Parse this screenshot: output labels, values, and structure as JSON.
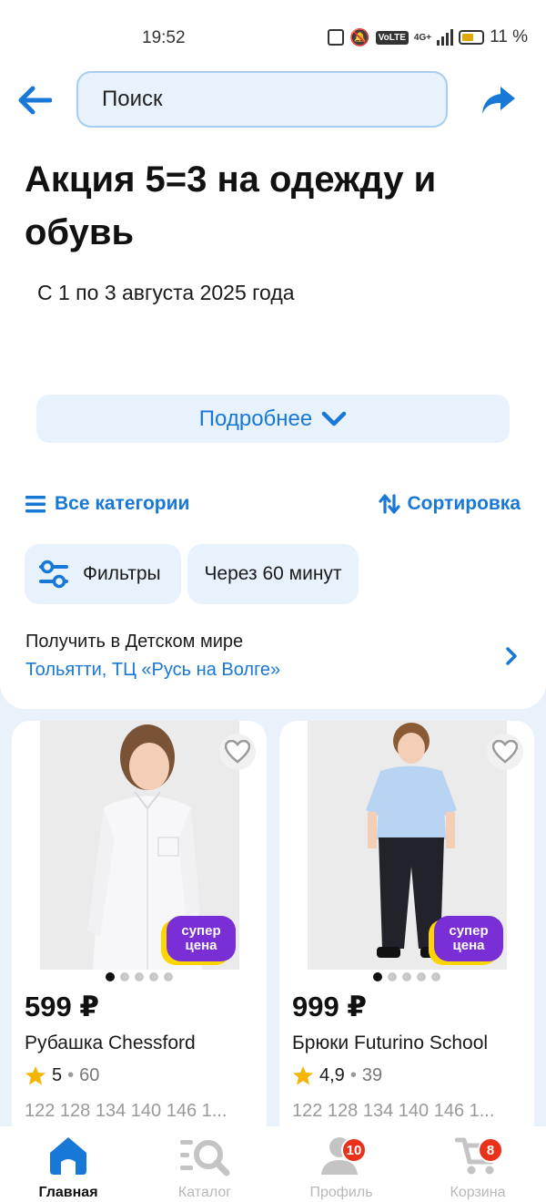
{
  "status_bar": {
    "time": "19:52",
    "network": "4G+",
    "battery": "11 %"
  },
  "header": {
    "search_placeholder": "Поиск"
  },
  "promo": {
    "title": "Акция 5=3 на одежду и обувь",
    "dates": "С 1 по 3 августа 2025 года",
    "more_label": "Подробнее"
  },
  "toolbar": {
    "categories_label": "Все категории",
    "sort_label": "Сортировка"
  },
  "chips": {
    "filters_label": "Фильтры",
    "time_label": "Через 60 минут"
  },
  "pickup": {
    "label": "Получить в Детском мире",
    "store": "Тольятти, ТЦ «Русь на Волге»"
  },
  "products": [
    {
      "price": "599 ₽",
      "name": "Рубашка Chessford",
      "rating": "5",
      "reviews": "60",
      "sizes": "122 128 134 140 146 1...",
      "badge_line1": "супер",
      "badge_line2": "цена"
    },
    {
      "price": "999 ₽",
      "name": "Брюки Futurino School",
      "rating": "4,9",
      "reviews": "39",
      "sizes": "122 128 134 140 146 1...",
      "badge_line1": "супер",
      "badge_line2": "цена"
    }
  ],
  "bottom_nav": {
    "home": "Главная",
    "catalog": "Каталог",
    "profile": "Профиль",
    "profile_badge": "10",
    "cart": "Корзина",
    "cart_badge": "8"
  },
  "colors": {
    "accent": "#1878d8",
    "badge_red": "#e8321c",
    "super_price_purple": "#7a2fd6",
    "super_price_yellow": "#ffd500",
    "star": "#f5b400"
  },
  "icons": [
    "back-arrow-icon",
    "share-icon",
    "chevron-down-icon",
    "menu-lines-icon",
    "sort-arrows-icon",
    "filter-sliders-icon",
    "chevron-right-icon",
    "heart-icon",
    "star-icon",
    "home-icon",
    "catalog-search-icon",
    "profile-icon",
    "cart-icon"
  ]
}
